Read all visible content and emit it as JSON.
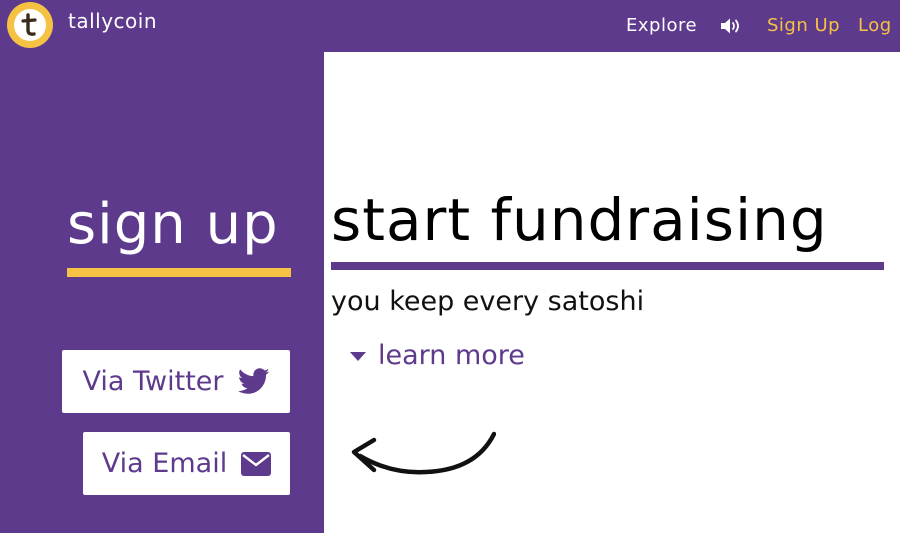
{
  "brand": {
    "name": "tallycoin",
    "logo_letter": "t",
    "logo_icon": "tallycoin-logo-icon"
  },
  "nav": {
    "explore_label": "Explore",
    "sound_icon": "speaker-icon",
    "signup_label": "Sign Up",
    "login_label": "Log"
  },
  "signup_panel": {
    "heading": "sign up",
    "twitter_button_label": "Via Twitter",
    "twitter_icon": "twitter-bird-icon",
    "email_button_label": "Via Email",
    "email_icon": "envelope-icon"
  },
  "main": {
    "headline": "start fundraising",
    "tagline": "you keep every satoshi",
    "learn_more_label": "learn more",
    "learn_more_icon": "caret-down-icon",
    "arrow_icon": "curved-arrow-icon"
  },
  "colors": {
    "brand_purple": "#5e3a8c",
    "accent_yellow": "#f6c244",
    "background_white": "#ffffff",
    "text_black": "#000000"
  }
}
